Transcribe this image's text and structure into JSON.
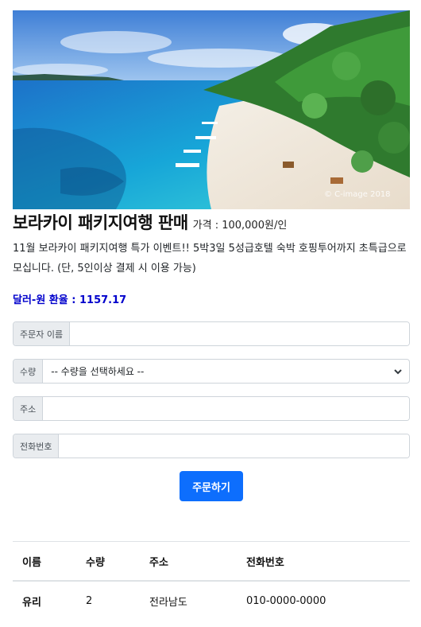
{
  "hero": {
    "image_alt": "Boracay beach aerial view",
    "watermark": "© C-image 2018"
  },
  "product": {
    "title": "보라카이 패키지여행 판매",
    "price": "가격 : 100,000원/인",
    "description": "11월 보라카이 패키지여행 특가 이벤트!! 5박3일 5성급호텔 숙박 호핑투어까지 초특급으로 모십니다. (단, 5인이상 결제 시 이용 가능)",
    "exchange_rate": "달러-원 환율 : 1157.17"
  },
  "form": {
    "name_label": "주문자 이름",
    "name_value": "",
    "quantity_label": "수량",
    "quantity_selected": "-- 수량을 선택하세요 --",
    "address_label": "주소",
    "address_value": "",
    "phone_label": "전화번호",
    "phone_value": "",
    "submit_label": "주문하기"
  },
  "orders": {
    "headers": {
      "name": "이름",
      "quantity": "수량",
      "address": "주소",
      "phone": "전화번호"
    },
    "rows": [
      {
        "name": "유리",
        "quantity": "2",
        "address": "전라남도",
        "phone": "010-0000-0000"
      }
    ]
  },
  "colors": {
    "accent": "#0d6efd",
    "rate_text": "#0000cc"
  }
}
